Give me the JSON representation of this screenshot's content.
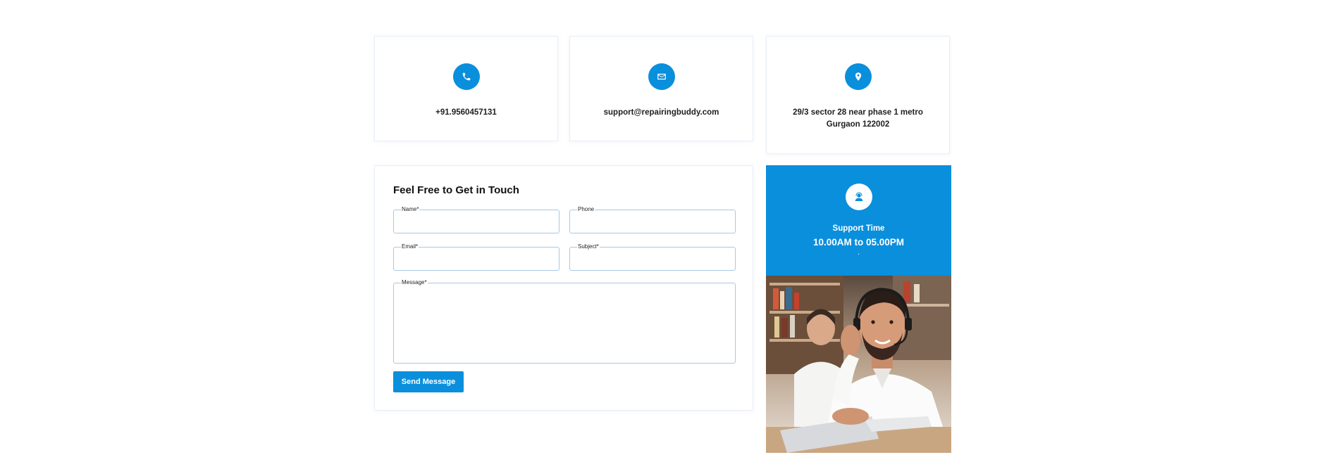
{
  "contact_cards": [
    {
      "icon": "phone-icon",
      "text": "+91.9560457131"
    },
    {
      "icon": "mail-icon",
      "text": "support@repairingbuddy.com"
    },
    {
      "icon": "location-pin-icon",
      "line1": "29/3 sector 28 near phase 1 metro",
      "line2": "Gurgaon 122002"
    }
  ],
  "form": {
    "title": "Feel Free to Get in Touch",
    "fields": {
      "name": {
        "label": "Name*",
        "value": ""
      },
      "phone": {
        "label": "Phone",
        "value": ""
      },
      "email": {
        "label": "Email*",
        "value": ""
      },
      "subject": {
        "label": "Subject*",
        "value": ""
      },
      "message": {
        "label": "Message*",
        "value": ""
      }
    },
    "submit_label": "Send Message"
  },
  "support": {
    "icon": "support-agent-icon",
    "title": "Support Time",
    "hours": "10.00AM to 05.00PM",
    "dot": "."
  },
  "photo": {
    "description_icon": "support-agent-photo"
  },
  "colors": {
    "accent": "#0a8fdc",
    "field_border": "#a9c8e3",
    "card_border": "#e9eef6"
  }
}
